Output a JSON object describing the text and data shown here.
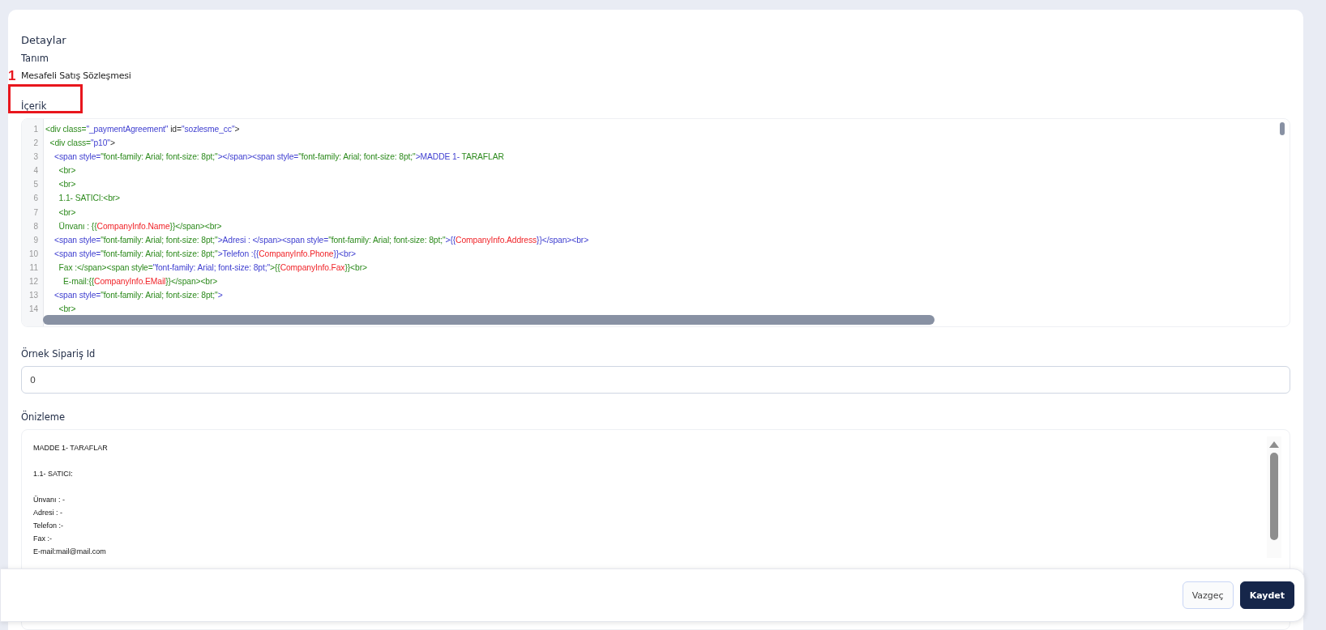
{
  "section_title": "Detaylar",
  "definition": {
    "label": "Tanım",
    "value": "Mesafeli Satış Sözleşmesi"
  },
  "annotation": {
    "label": "1"
  },
  "content": {
    "label": "İçerik",
    "lines": [
      {
        "number": "1",
        "tokens": [
          {
            "kind": "tag",
            "text": "<div class="
          },
          {
            "kind": "value",
            "text": "\"_paymentAgreement\""
          },
          {
            "kind": "plain",
            "text": " id="
          },
          {
            "kind": "value",
            "text": "\"sozlesme_cc\""
          },
          {
            "kind": "plain",
            "text": ">"
          }
        ]
      },
      {
        "number": "2",
        "tokens": [
          {
            "kind": "tag",
            "text": "  <div class="
          },
          {
            "kind": "value",
            "text": "\"p10\""
          },
          {
            "kind": "plain",
            "text": ">"
          }
        ]
      },
      {
        "number": "3",
        "tokens": [
          {
            "kind": "value",
            "text": "    <span style="
          },
          {
            "kind": "tag",
            "text": "\"font-family: Arial; font-size: 8pt;\""
          },
          {
            "kind": "value",
            "text": "></span><span style="
          },
          {
            "kind": "tag",
            "text": "\"font-family: Arial; font-size: 8pt;\""
          },
          {
            "kind": "value",
            "text": ">MADDE 1- "
          },
          {
            "kind": "tag",
            "text": "TARAFLAR"
          }
        ]
      },
      {
        "number": "4",
        "tokens": [
          {
            "kind": "tag",
            "text": "      <br>"
          }
        ]
      },
      {
        "number": "5",
        "tokens": [
          {
            "kind": "tag",
            "text": "      <br>"
          }
        ]
      },
      {
        "number": "6",
        "tokens": [
          {
            "kind": "tag",
            "text": "      1.1- SATICI:<br>"
          }
        ]
      },
      {
        "number": "7",
        "tokens": [
          {
            "kind": "tag",
            "text": "      <br>"
          }
        ]
      },
      {
        "number": "8",
        "tokens": [
          {
            "kind": "tag",
            "text": "      Ünvanı : {{"
          },
          {
            "kind": "variable",
            "text": "CompanyInfo.Name"
          },
          {
            "kind": "tag",
            "text": "}}</span><br>"
          }
        ]
      },
      {
        "number": "9",
        "tokens": [
          {
            "kind": "value",
            "text": "    <span style="
          },
          {
            "kind": "tag",
            "text": "\"font-family: Arial; font-size: 8pt;\""
          },
          {
            "kind": "value",
            "text": ">Adresi : </span><span style="
          },
          {
            "kind": "tag",
            "text": "\"font-family: Arial; font-size: 8pt;\""
          },
          {
            "kind": "value",
            "text": ">{{"
          },
          {
            "kind": "variable",
            "text": "CompanyInfo.Address"
          },
          {
            "kind": "value",
            "text": "}}</span><br>"
          }
        ]
      },
      {
        "number": "10",
        "tokens": [
          {
            "kind": "value",
            "text": "    <span style="
          },
          {
            "kind": "tag",
            "text": "\"font-family: Arial; font-size: 8pt;\""
          },
          {
            "kind": "value",
            "text": ">Telefon :{{"
          },
          {
            "kind": "variable",
            "text": "CompanyInfo.Phone"
          },
          {
            "kind": "value",
            "text": "}}<br>"
          }
        ]
      },
      {
        "number": "11",
        "tokens": [
          {
            "kind": "tag",
            "text": "      Fax :</span><span style="
          },
          {
            "kind": "value",
            "text": "\"font-family: Arial; font-size: 8pt;\""
          },
          {
            "kind": "tag",
            "text": ">{{"
          },
          {
            "kind": "variable",
            "text": "CompanyInfo.Fax"
          },
          {
            "kind": "tag",
            "text": "}}<br>"
          }
        ]
      },
      {
        "number": "12",
        "tokens": [
          {
            "kind": "tag",
            "text": "        E-mail:{{"
          },
          {
            "kind": "variable",
            "text": "CompanyInfo.EMail"
          },
          {
            "kind": "tag",
            "text": "}}</span><br>"
          }
        ]
      },
      {
        "number": "13",
        "tokens": [
          {
            "kind": "value",
            "text": "    <span style="
          },
          {
            "kind": "tag",
            "text": "\"font-family: Arial; font-size: 8pt;\""
          },
          {
            "kind": "value",
            "text": ">"
          }
        ]
      },
      {
        "number": "14",
        "tokens": [
          {
            "kind": "tag",
            "text": "      <br>"
          }
        ]
      }
    ]
  },
  "sample_order": {
    "label": "Örnek Sipariş Id",
    "value": "0"
  },
  "preview": {
    "label": "Önizleme",
    "paragraphs": [
      [
        "MADDE 1- TARAFLAR"
      ],
      [
        "1.1- SATICI:"
      ],
      [
        "Ünvanı : -",
        "Adresi : -",
        "Telefon :-",
        "Fax :-",
        "E-mail:mail@mail.com"
      ]
    ]
  },
  "buttons": [
    {
      "kind": "secondary",
      "label": "Vazgeç"
    },
    {
      "kind": "primary",
      "label": "Kaydet"
    }
  ]
}
